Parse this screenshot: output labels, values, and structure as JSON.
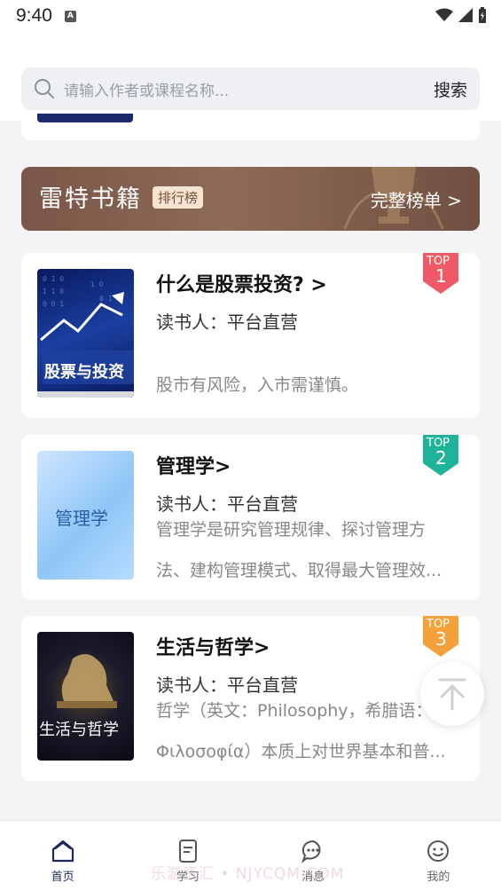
{
  "status": {
    "time": "9:40",
    "notification_icon": "A"
  },
  "search": {
    "placeholder": "请输入作者或课程名称...",
    "button_label": "搜索"
  },
  "banner": {
    "title": "雷特书籍",
    "badge": "排行榜",
    "link": "完整榜单 >"
  },
  "books": [
    {
      "title": "什么是股票投资? >",
      "reader": "读书人：平台直营",
      "desc_lines": [
        "股市有风险，入市需谨慎。"
      ],
      "cover_text": "股票与投资",
      "rank_top": "TOP",
      "rank_num": "1",
      "rank_color": "#f05a67"
    },
    {
      "title": "管理学>",
      "reader": "读书人：平台直营",
      "desc_lines": [
        "管理学是研究管理规律、探讨管理方",
        "法、建构管理模式、取得最大管理效..."
      ],
      "cover_text": "管理学",
      "rank_top": "TOP",
      "rank_num": "2",
      "rank_color": "#1fb39a"
    },
    {
      "title": "生活与哲学>",
      "reader": "读书人：平台直营",
      "desc_lines": [
        "哲学（英文：Philosophy，希腊语：",
        "Φιλοσοφία）本质上对世界基本和普..."
      ],
      "cover_text": "生活与哲学",
      "rank_top": "TOP",
      "rank_num": "3",
      "rank_color": "#f4a13a"
    }
  ],
  "tabs": [
    {
      "label": "首页",
      "icon": "home-icon",
      "active": true
    },
    {
      "label": "学习",
      "icon": "book-icon",
      "active": false
    },
    {
      "label": "消息",
      "icon": "message-icon",
      "active": false
    },
    {
      "label": "我的",
      "icon": "profile-icon",
      "active": false
    }
  ],
  "watermark": "乐游资汇 • NJYCQM.COM"
}
